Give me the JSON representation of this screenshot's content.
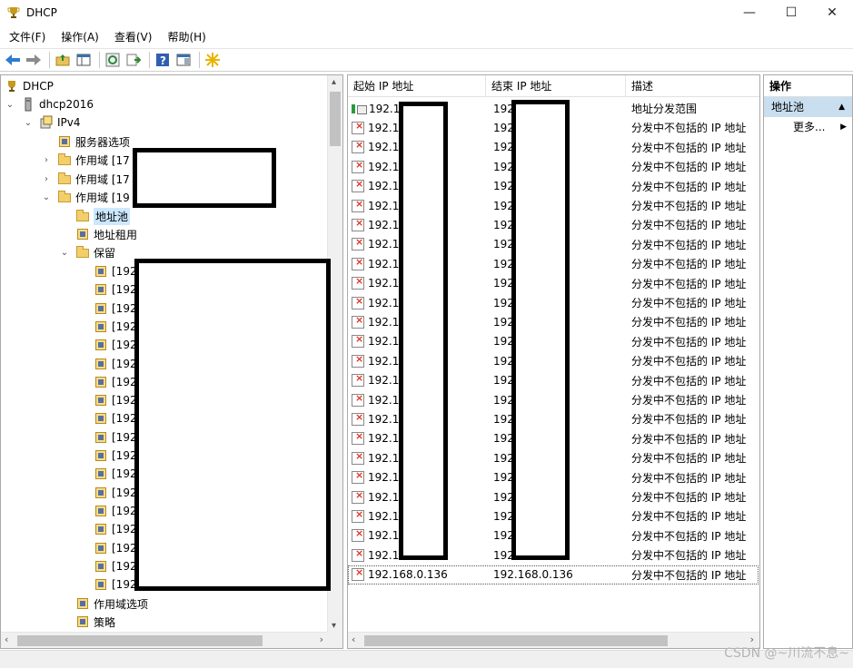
{
  "window": {
    "title": "DHCP"
  },
  "window_controls": {
    "minimize": "—",
    "maximize": "☐",
    "close": "✕"
  },
  "menu": [
    "文件(F)",
    "操作(A)",
    "查看(V)",
    "帮助(H)"
  ],
  "toolbar": {
    "icons": [
      "back-arrow-icon",
      "forward-arrow-icon",
      "up-folder-icon",
      "show-console-tree-icon",
      "refresh-icon",
      "export-list-icon",
      "help-icon",
      "show-action-pane-icon",
      "new-star-icon"
    ]
  },
  "tree": {
    "root": "DHCP",
    "server": "dhcp2016",
    "ipv4": "IPv4",
    "server_options": "服务器选项",
    "scope1": "作用域 [17",
    "scope2": "作用域 [17",
    "scope3": "作用域 [19",
    "address_pool": "地址池",
    "address_leases": "地址租用",
    "reservations": "保留",
    "reservation_items": [
      "[192",
      "[192",
      "[192",
      "[192",
      "[192",
      "[192",
      "[192",
      "[192",
      "[192",
      "[192",
      "[192",
      "[192",
      "[192",
      "[192",
      "[192",
      "[192",
      "[192",
      "[192"
    ],
    "scope_options": "作用域选项",
    "policies": "策略"
  },
  "list": {
    "columns": [
      "起始 IP 地址",
      "结束 IP 地址",
      "描述"
    ],
    "rows": [
      {
        "start": "192.1",
        "end": "192",
        "desc": "地址分发范围",
        "type": "range"
      },
      {
        "start": "192.1",
        "end": "192",
        "desc": "分发中不包括的 IP 地址",
        "type": "exclusion"
      },
      {
        "start": "192.1",
        "end": "192",
        "desc": "分发中不包括的 IP 地址",
        "type": "exclusion"
      },
      {
        "start": "192.1",
        "end": "192",
        "desc": "分发中不包括的 IP 地址",
        "type": "exclusion"
      },
      {
        "start": "192.1",
        "end": "192",
        "desc": "分发中不包括的 IP 地址",
        "type": "exclusion"
      },
      {
        "start": "192.1",
        "end": "192",
        "desc": "分发中不包括的 IP 地址",
        "type": "exclusion"
      },
      {
        "start": "192.1",
        "end": "192",
        "desc": "分发中不包括的 IP 地址",
        "type": "exclusion"
      },
      {
        "start": "192.1",
        "end": "192",
        "desc": "分发中不包括的 IP 地址",
        "type": "exclusion"
      },
      {
        "start": "192.1",
        "end": "192",
        "desc": "分发中不包括的 IP 地址",
        "type": "exclusion"
      },
      {
        "start": "192.1",
        "end": "192",
        "desc": "分发中不包括的 IP 地址",
        "type": "exclusion"
      },
      {
        "start": "192.1",
        "end": "192",
        "desc": "分发中不包括的 IP 地址",
        "type": "exclusion"
      },
      {
        "start": "192.1",
        "end": "192",
        "desc": "分发中不包括的 IP 地址",
        "type": "exclusion"
      },
      {
        "start": "192.1",
        "end": "192",
        "desc": "分发中不包括的 IP 地址",
        "type": "exclusion"
      },
      {
        "start": "192.1",
        "end": "192",
        "desc": "分发中不包括的 IP 地址",
        "type": "exclusion"
      },
      {
        "start": "192.1",
        "end": "192",
        "desc": "分发中不包括的 IP 地址",
        "type": "exclusion"
      },
      {
        "start": "192.1",
        "end": "192",
        "desc": "分发中不包括的 IP 地址",
        "type": "exclusion"
      },
      {
        "start": "192.1",
        "end": "192",
        "desc": "分发中不包括的 IP 地址",
        "type": "exclusion"
      },
      {
        "start": "192.1",
        "end": "192",
        "desc": "分发中不包括的 IP 地址",
        "type": "exclusion"
      },
      {
        "start": "192.1",
        "end": "192",
        "desc": "分发中不包括的 IP 地址",
        "type": "exclusion"
      },
      {
        "start": "192.1",
        "end": "192",
        "desc": "分发中不包括的 IP 地址",
        "type": "exclusion"
      },
      {
        "start": "192.1",
        "end": "192",
        "desc": "分发中不包括的 IP 地址",
        "type": "exclusion"
      },
      {
        "start": "192.1",
        "end": "192",
        "desc": "分发中不包括的 IP 地址",
        "type": "exclusion"
      },
      {
        "start": "192.1",
        "end": "192",
        "desc": "分发中不包括的 IP 地址",
        "type": "exclusion"
      },
      {
        "start": "192.1",
        "end": "192",
        "desc": "分发中不包括的 IP 地址",
        "type": "exclusion"
      },
      {
        "start": "192.168.0.136",
        "end": "192.168.0.136",
        "desc": "分发中不包括的 IP 地址",
        "type": "exclusion"
      }
    ]
  },
  "actions": {
    "header": "操作",
    "section": "地址池",
    "more": "更多..."
  },
  "watermark": "CSDN @~川流不息~",
  "colors": {
    "selection": "#cce8ff",
    "action_section": "#c9dff0",
    "redaction": "#000000"
  }
}
